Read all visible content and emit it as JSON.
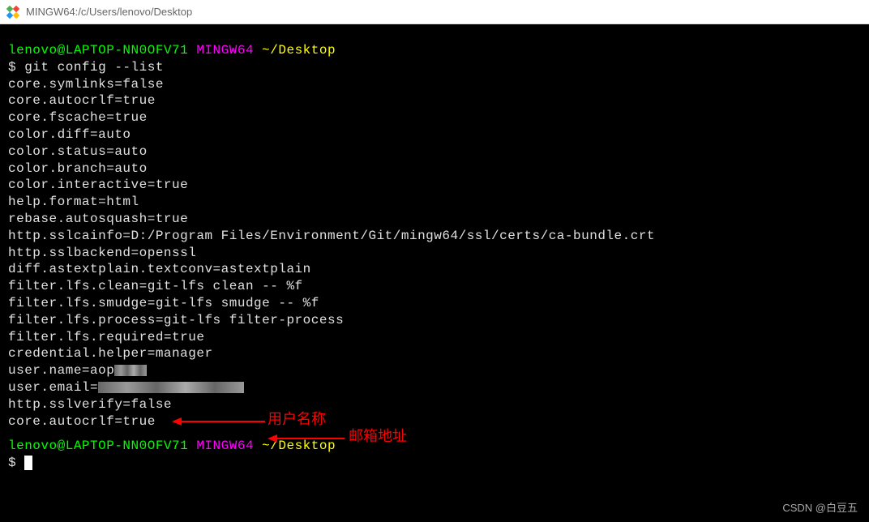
{
  "titlebar": {
    "title": "MINGW64:/c/Users/lenovo/Desktop"
  },
  "prompt1": {
    "user_host": "lenovo@LAPTOP-NN0OFV71",
    "env": "MINGW64",
    "path": "~/Desktop"
  },
  "command1": "$ git config --list",
  "output": [
    "core.symlinks=false",
    "core.autocrlf=true",
    "core.fscache=true",
    "color.diff=auto",
    "color.status=auto",
    "color.branch=auto",
    "color.interactive=true",
    "help.format=html",
    "rebase.autosquash=true",
    "http.sslcainfo=D:/Program Files/Environment/Git/mingw64/ssl/certs/ca-bundle.crt",
    "http.sslbackend=openssl",
    "diff.astextplain.textconv=astextplain",
    "filter.lfs.clean=git-lfs clean -- %f",
    "filter.lfs.smudge=git-lfs smudge -- %f",
    "filter.lfs.process=git-lfs filter-process",
    "filter.lfs.required=true",
    "credential.helper=manager"
  ],
  "user_name_line": "user.name=aop",
  "user_email_line": "user.email=",
  "output_tail": [
    "http.sslverify=false",
    "core.autocrlf=true"
  ],
  "prompt2": {
    "user_host": "lenovo@LAPTOP-NN0OFV71",
    "env": "MINGW64",
    "path": "~/Desktop"
  },
  "command2": "$ ",
  "annotations": {
    "username_label": "用户名称",
    "email_label": "邮箱地址"
  },
  "watermark": "CSDN @白豆五"
}
